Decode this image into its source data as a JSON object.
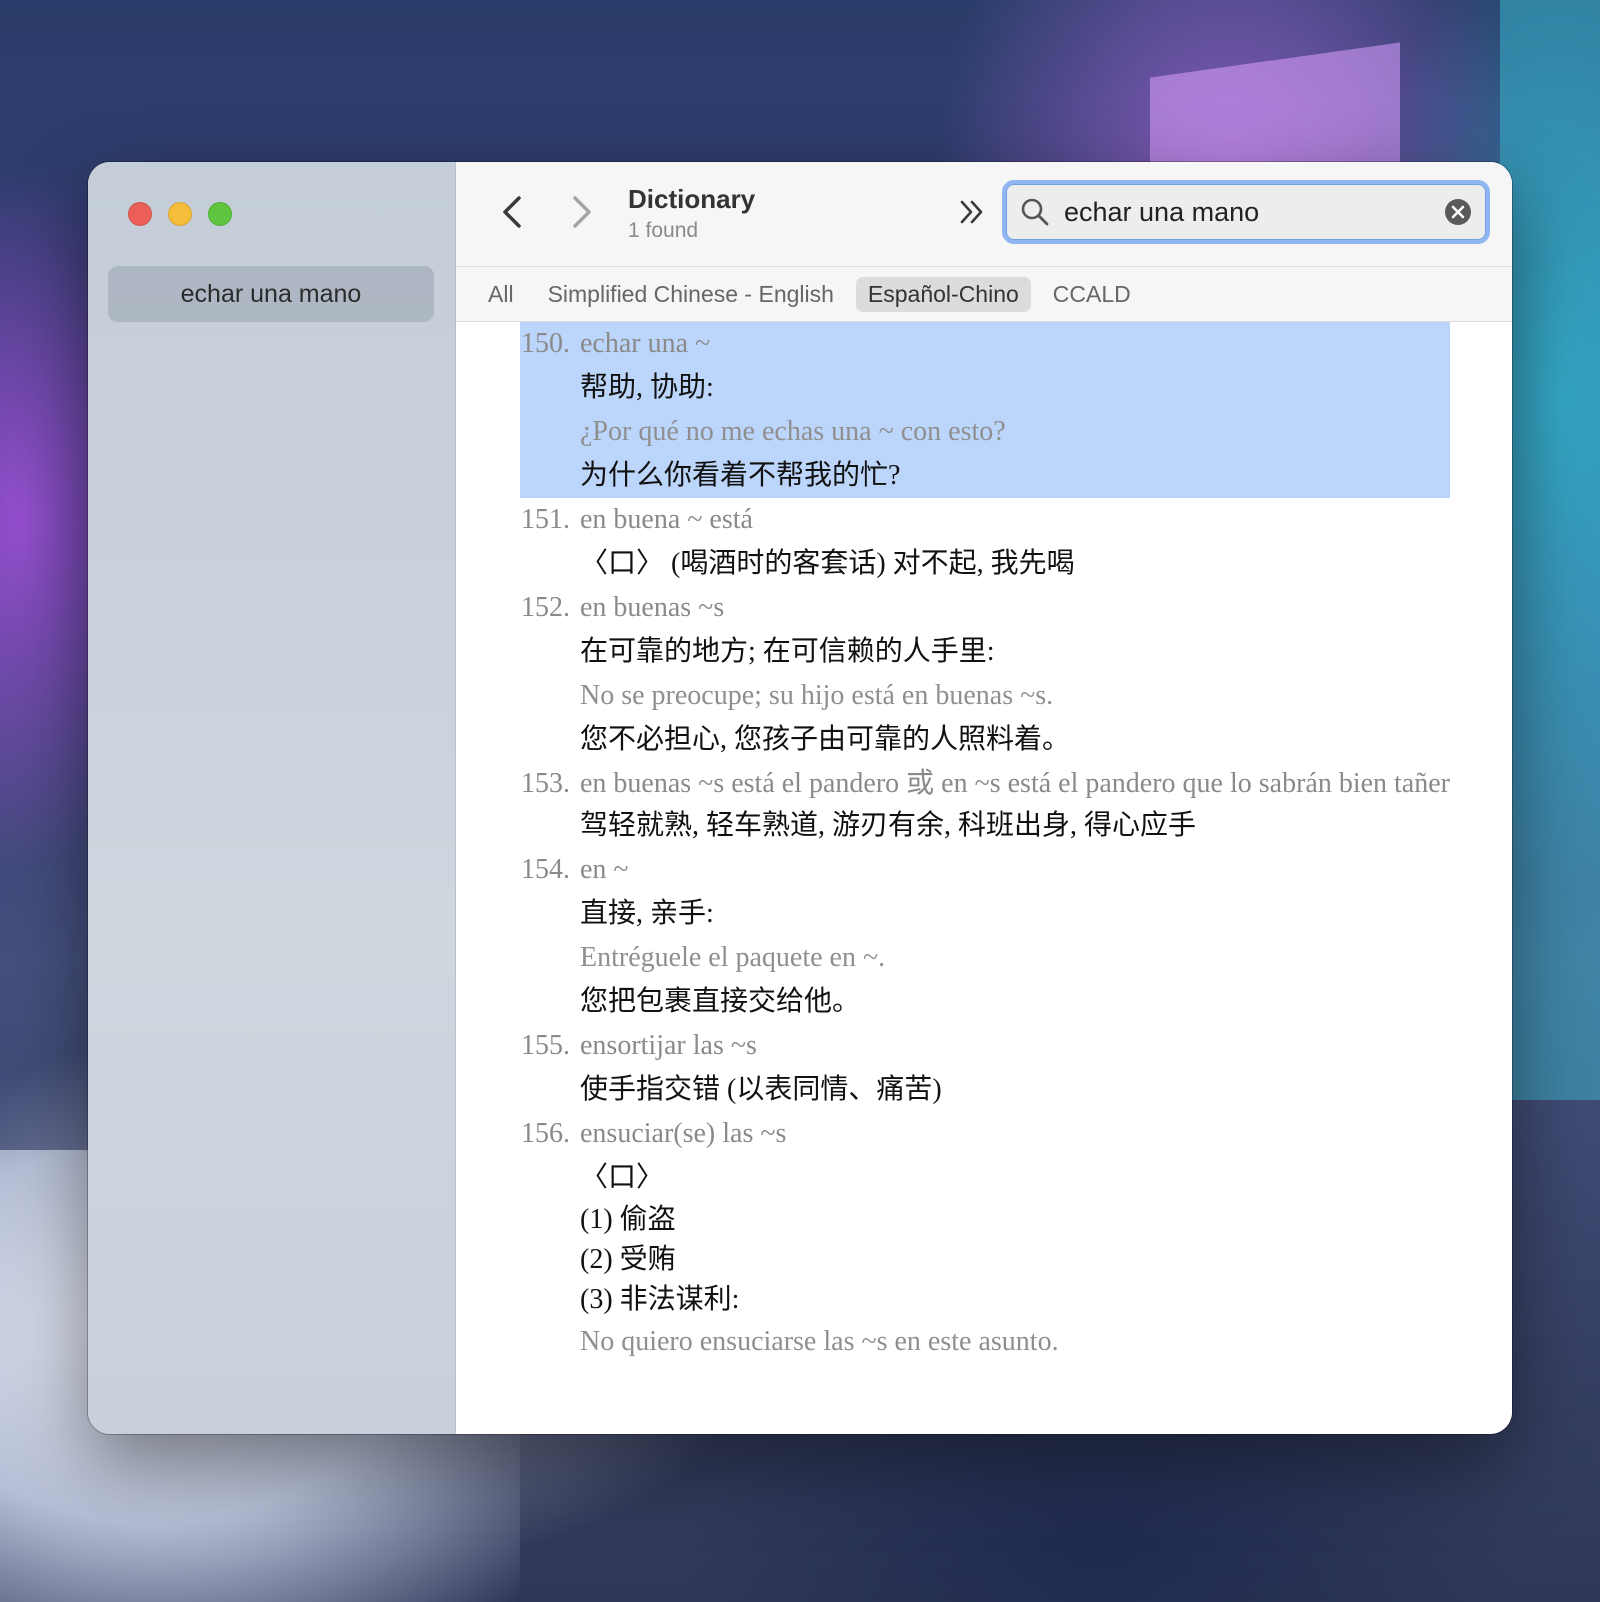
{
  "window": {
    "sidebar": {
      "items": [
        {
          "label": "echar una mano"
        }
      ]
    },
    "toolbar": {
      "title": "Dictionary",
      "subtitle": "1 found"
    },
    "search": {
      "value": "echar una mano",
      "placeholder": ""
    },
    "tabs": [
      {
        "label": "All",
        "active": false
      },
      {
        "label": "Simplified Chinese - English",
        "active": false
      },
      {
        "label": "Español-Chino",
        "active": true
      },
      {
        "label": "CCALD",
        "active": false
      }
    ]
  },
  "entries": [
    {
      "num": "150.",
      "head": "echar una ~",
      "selected": true,
      "lines": [
        {
          "type": "cn",
          "text": "帮助, 协助:"
        },
        {
          "type": "es",
          "text": "¿Por qué no me echas una ~ con esto?"
        },
        {
          "type": "cn",
          "text": "为什么你看着不帮我的忙?"
        }
      ]
    },
    {
      "num": "151.",
      "head": "en buena ~ está",
      "selected": false,
      "lines": [
        {
          "type": "cn",
          "text": "〈口〉 (喝酒时的客套话) 对不起, 我先喝"
        }
      ]
    },
    {
      "num": "152.",
      "head": "en buenas ~s",
      "selected": false,
      "lines": [
        {
          "type": "cn",
          "text": "在可靠的地方; 在可信赖的人手里:"
        },
        {
          "type": "es",
          "text": "No se preocupe; su hijo está en buenas ~s."
        },
        {
          "type": "cn",
          "text": "您不必担心, 您孩子由可靠的人照料着。"
        }
      ]
    },
    {
      "num": "153.",
      "head": "en buenas ~s está el pandero 或 en ~s está el pandero que lo sabrán bien tañer",
      "selected": false,
      "lines": [
        {
          "type": "cn",
          "text": "驾轻就熟, 轻车熟道, 游刃有余, 科班出身, 得心应手"
        }
      ]
    },
    {
      "num": "154.",
      "head": "en ~",
      "selected": false,
      "lines": [
        {
          "type": "cn",
          "text": "直接, 亲手:"
        },
        {
          "type": "es",
          "text": "Entréguele el paquete en ~."
        },
        {
          "type": "cn",
          "text": "您把包裹直接交给他。"
        }
      ]
    },
    {
      "num": "155.",
      "head": "ensortijar las ~s",
      "selected": false,
      "lines": [
        {
          "type": "cn",
          "text": "使手指交错 (以表同情、痛苦)"
        }
      ]
    },
    {
      "num": "156.",
      "head": "ensuciar(se) las ~s",
      "selected": false,
      "lines": [
        {
          "type": "cn",
          "text": "〈口〉"
        },
        {
          "type": "sub",
          "text": "(1) 偷盗"
        },
        {
          "type": "sub",
          "text": "(2) 受贿"
        },
        {
          "type": "sub",
          "text": "(3) 非法谋利:"
        },
        {
          "type": "es",
          "text": "No quiero ensuciarse las ~s en este asunto."
        }
      ]
    }
  ],
  "colors": {
    "selection": "#bcd5fa",
    "accent": "#2f7bf6",
    "close": "#ec5f58",
    "minimize": "#f4be3b",
    "zoom": "#5ec53f"
  },
  "icons": [
    "chevron-left-icon",
    "chevron-right-icon",
    "double-chevron-right-icon",
    "search-icon",
    "clear-icon"
  ]
}
